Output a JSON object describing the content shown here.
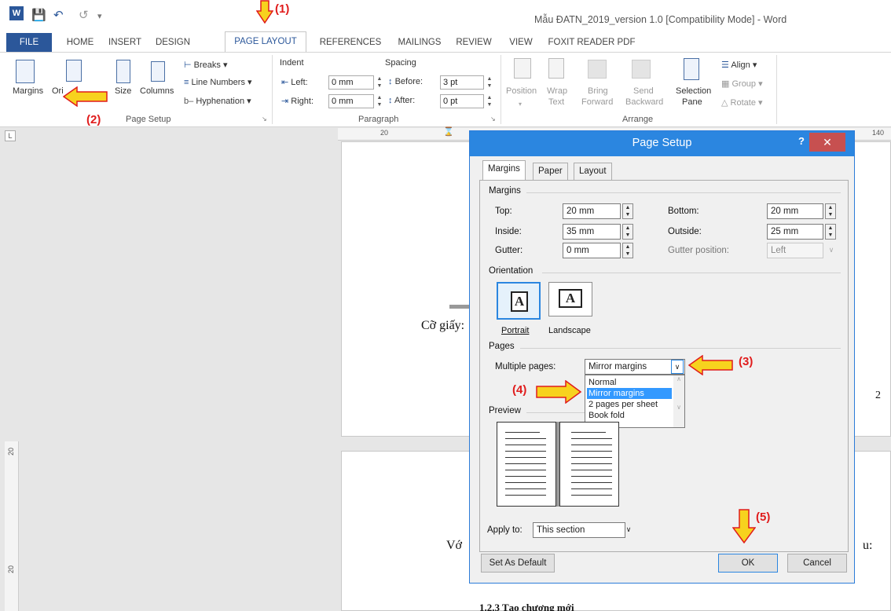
{
  "window": {
    "title": "Mẫu ĐATN_2019_version 1.0 [Compatibility Mode] - Word"
  },
  "tabs": [
    "FILE",
    "HOME",
    "INSERT",
    "DESIGN",
    "PAGE LAYOUT",
    "REFERENCES",
    "MAILINGS",
    "REVIEW",
    "VIEW",
    "FOXIT READER PDF"
  ],
  "ribbon": {
    "page_setup": {
      "margins": "Margins",
      "orientation": "Ori",
      "size": "Size",
      "columns": "Columns",
      "breaks": "Breaks",
      "line_numbers": "Line Numbers",
      "hyphenation": "Hyphenation",
      "group_label": "Page Setup"
    },
    "paragraph": {
      "indent": "Indent",
      "spacing": "Spacing",
      "left_label": "Left:",
      "right_label": "Right:",
      "left_value": "0 mm",
      "right_value": "0 mm",
      "before_label": "Before:",
      "after_label": "After:",
      "before_value": "3 pt",
      "after_value": "0 pt",
      "group_label": "Paragraph"
    },
    "arrange": {
      "position": "Position",
      "wrap_text_1": "Wrap",
      "wrap_text_2": "Text",
      "bring_forward_1": "Bring",
      "bring_forward_2": "Forward",
      "send_backward_1": "Send",
      "send_backward_2": "Backward",
      "selection_pane_1": "Selection",
      "selection_pane_2": "Pane",
      "align": "Align",
      "group": "Group",
      "rotate": "Rotate",
      "group_label": "Arrange"
    }
  },
  "ruler": {
    "h_marks": [
      "20",
      "140"
    ],
    "v_marks": [
      "20",
      "20"
    ],
    "corner": "L"
  },
  "document": {
    "text_paper_size": "Cỡ giấy:",
    "text_with": "Vớ",
    "text_end": "u:",
    "page_number": "2",
    "heading": "1.2.3      Tạo chương mới"
  },
  "dialog": {
    "title": "Page Setup",
    "help": "?",
    "close": "✕",
    "tabs": [
      "Margins",
      "Paper",
      "Layout"
    ],
    "margins_section": "Margins",
    "top_label": "Top:",
    "top_value": "20 mm",
    "bottom_label": "Bottom:",
    "bottom_value": "20 mm",
    "inside_label": "Inside:",
    "inside_value": "35 mm",
    "outside_label": "Outside:",
    "outside_value": "25 mm",
    "gutter_label": "Gutter:",
    "gutter_value": "0 mm",
    "gutter_position_label": "Gutter position:",
    "gutter_position_value": "Left",
    "orientation_section": "Orientation",
    "portrait": "Portrait",
    "landscape": "Landscape",
    "pages_section": "Pages",
    "multiple_pages_label": "Multiple pages:",
    "multiple_pages_value": "Mirror margins",
    "multiple_pages_options": [
      "Normal",
      "Mirror margins",
      "2 pages per sheet",
      "Book fold"
    ],
    "preview_section": "Preview",
    "apply_to_label": "Apply to:",
    "apply_to_value": "This section",
    "set_default": "Set As Default",
    "ok": "OK",
    "cancel": "Cancel"
  },
  "annotations": {
    "step1": "(1)",
    "step2": "(2)",
    "step3": "(3)",
    "step4": "(4)",
    "step5": "(5)"
  },
  "colors": {
    "accent": "#2b579a",
    "dialog_title": "#2b86e0",
    "annotation": "#e01c1c",
    "arrow_fill": "#f7d21e"
  }
}
